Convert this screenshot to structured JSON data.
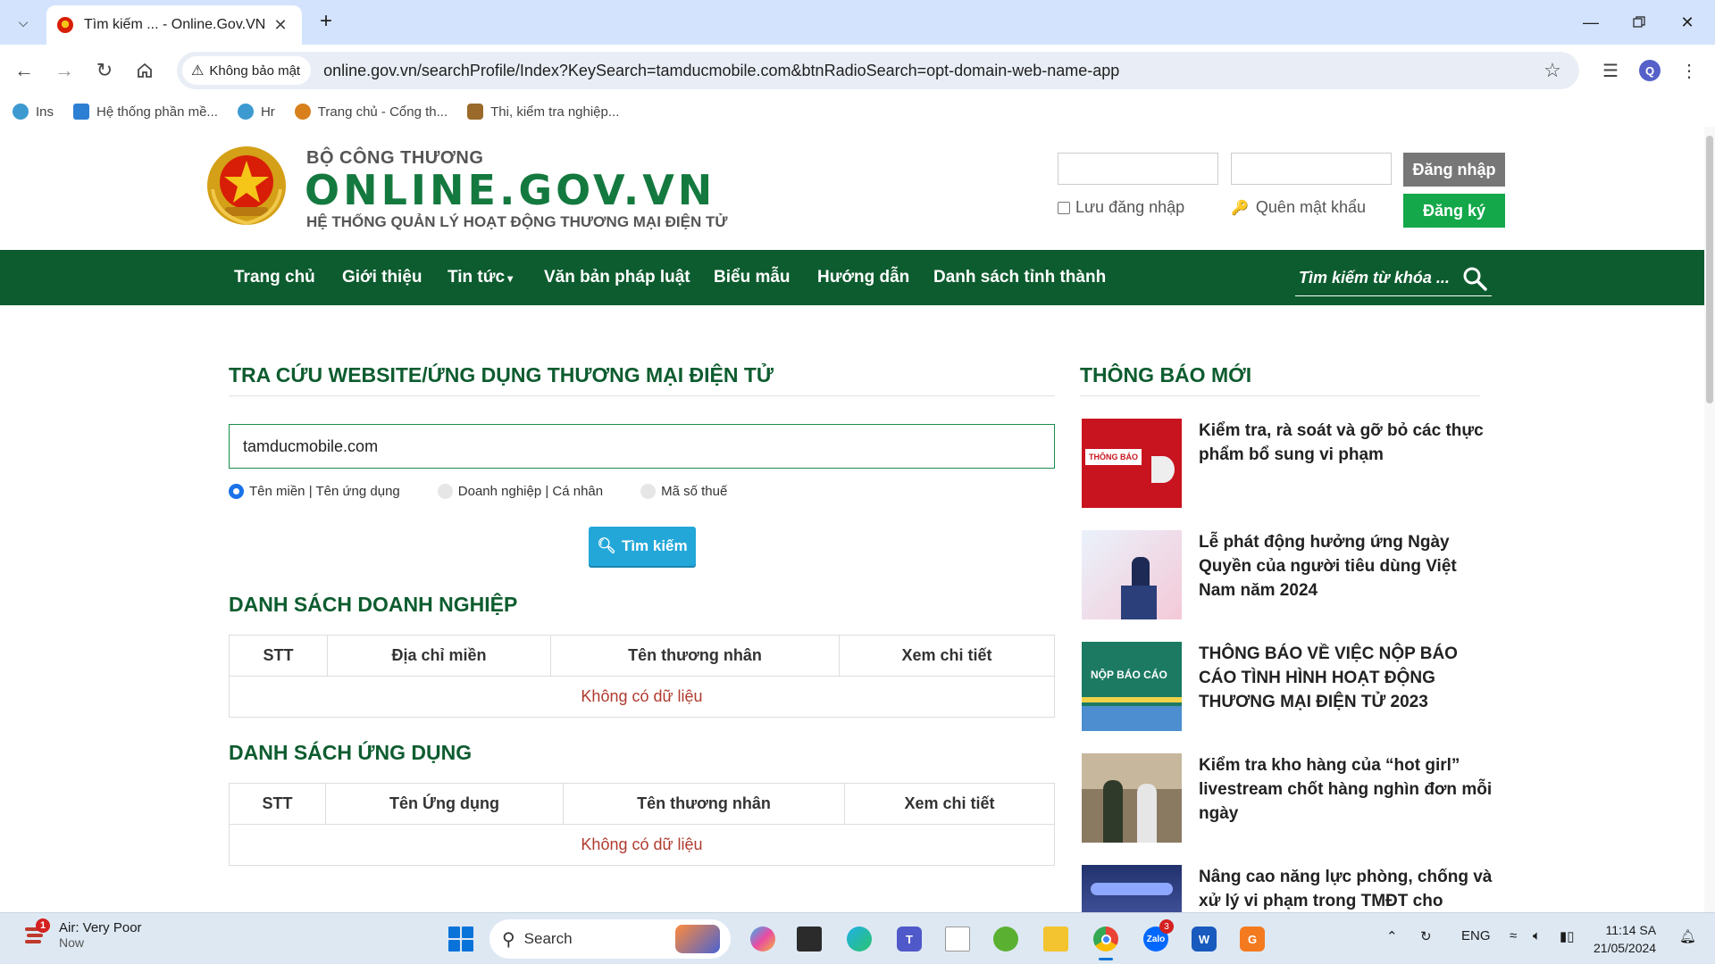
{
  "browser": {
    "tab_title": "Tìm kiếm ... - Online.Gov.VN",
    "security_label": "Không bảo mật",
    "url": "online.gov.vn/searchProfile/Index?KeySearch=tamducmobile.com&btnRadioSearch=opt-domain-web-name-app",
    "profile_initial": "Q",
    "bookmarks": [
      {
        "label": "Ins",
        "color": "#3d9ad1"
      },
      {
        "label": "Hệ thống phần mề...",
        "color": "#2d7fd3"
      },
      {
        "label": "Hr",
        "color": "#3d9ad1"
      },
      {
        "label": "Trang chủ - Cổng th...",
        "color": "#d8801c"
      },
      {
        "label": "Thi, kiểm tra nghiệp...",
        "color": "#9a6a2a"
      }
    ]
  },
  "header": {
    "brand_top": "BỘ CÔNG THƯƠNG",
    "brand_main": "ONLINE.GOV.VN",
    "brand_sub": "HỆ THỐNG QUẢN LÝ HOẠT ĐỘNG THƯƠNG MẠI ĐIỆN TỬ",
    "login_label": "Đăng nhập",
    "remember_label": "Lưu đăng nhập",
    "forgot_label": "Quên mật khẩu",
    "register_label": "Đăng ký"
  },
  "nav": {
    "items": [
      "Trang chủ",
      "Giới thiệu",
      "Tin tức",
      "Văn bản pháp luật",
      "Biểu mẫu",
      "Hướng dẫn",
      "Danh sách tỉnh thành"
    ],
    "search_placeholder": "Tìm kiếm từ khóa ..."
  },
  "lookup": {
    "title": "TRA CỨU WEBSITE/ỨNG DỤNG THƯƠNG MẠI ĐIỆN TỬ",
    "query": "tamducmobile.com",
    "options": [
      "Tên miền | Tên ứng dụng",
      "Doanh nghiệp | Cá nhân",
      "Mã số thuế"
    ],
    "selected_option": "Tên miền | Tên ứng dụng",
    "search_button": "Tìm kiếm"
  },
  "business_list": {
    "title": "DANH SÁCH DOANH NGHIỆP",
    "columns": [
      "STT",
      "Địa chỉ miền",
      "Tên thương nhân",
      "Xem chi tiết"
    ],
    "empty_text": "Không có dữ liệu"
  },
  "app_list": {
    "title": "DANH SÁCH ỨNG DỤNG",
    "columns": [
      "STT",
      "Tên Ứng dụng",
      "Tên thương nhân",
      "Xem chi tiết"
    ],
    "empty_text": "Không có dữ liệu"
  },
  "news": {
    "title": "THÔNG BÁO MỚI",
    "items": [
      {
        "title": "Kiểm tra, rà soát và gỡ bỏ các thực phẩm bổ sung vi phạm",
        "thumb_text": "THÔNG BÁO"
      },
      {
        "title": "Lễ phát động hưởng ứng Ngày Quyền của người tiêu dùng Việt Nam năm 2024",
        "thumb_text": ""
      },
      {
        "title": "THÔNG BÁO VỀ VIỆC NỘP BÁO CÁO TÌNH HÌNH HOẠT ĐỘNG THƯƠNG MẠI ĐIỆN TỬ 2023",
        "thumb_text": "NỘP BÁO CÁO"
      },
      {
        "title": "Kiểm tra kho hàng của “hot girl” livestream chốt hàng nghìn đơn mỗi ngày",
        "thumb_text": ""
      },
      {
        "title": "Nâng cao năng lực phòng, chống và xử lý vi phạm trong TMĐT cho",
        "thumb_text": ""
      }
    ]
  },
  "taskbar": {
    "weather_title": "Air: Very Poor",
    "weather_sub": "Now",
    "weather_badge": "1",
    "search_label": "Search",
    "zalo_badge": "3",
    "language": "ENG",
    "time": "11:14 SA",
    "date": "21/05/2024"
  },
  "colors": {
    "brand_green": "#14793f",
    "nav_green": "#0d5c2f",
    "register_green": "#14a84a",
    "search_button": "#23a7d9",
    "empty_text": "#b03a2e"
  }
}
